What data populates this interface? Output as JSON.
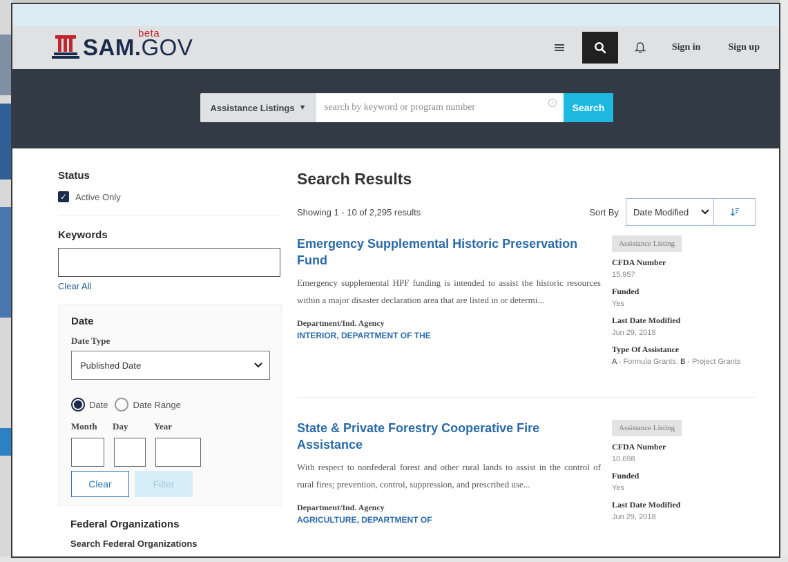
{
  "header": {
    "logo_main": "SAM.",
    "logo_gov": "GOV",
    "logo_beta": "beta",
    "sign_in": "Sign in",
    "sign_up": "Sign up"
  },
  "search": {
    "category": "Assistance Listings",
    "placeholder": "search by keyword or program number",
    "button": "Search"
  },
  "sidebar": {
    "status_title": "Status",
    "active_only": "Active Only",
    "keywords_title": "Keywords",
    "clear_all": "Clear All",
    "date_title": "Date",
    "date_type_label": "Date Type",
    "date_type_value": "Published Date",
    "radio_date": "Date",
    "radio_range": "Date Range",
    "month": "Month",
    "day": "Day",
    "year": "Year",
    "clear_btn": "Clear",
    "filter_btn": "Filter",
    "fed_title": "Federal Organizations",
    "fed_sub": "Search Federal Organizations"
  },
  "results": {
    "title": "Search Results",
    "showing": "Showing 1 - 10 of 2,295 results",
    "sort_label": "Sort By",
    "sort_value": "Date Modified",
    "items": [
      {
        "title": "Emergency Supplemental Historic Preservation Fund",
        "description": "Emergency supplemental HPF funding is intended to assist the historic resources within a major disaster declaration area that are listed in or determi...",
        "agency_label": "Department/Ind. Agency",
        "agency": "INTERIOR, DEPARTMENT OF THE",
        "tag": "Assistance Listing",
        "cfda_label": "CFDA Number",
        "cfda": "15.957",
        "funded_label": "Funded",
        "funded": "Yes",
        "modified_label": "Last Date Modified",
        "modified": "Jun 29, 2018",
        "type_label": "Type Of Assistance",
        "type_a_code": "A",
        "type_a": " - Formula Grants, ",
        "type_b_code": "B",
        "type_b": " - Project Grants"
      },
      {
        "title": "State & Private Forestry Cooperative Fire Assistance",
        "description": "With respect to nonfederal forest and other rural lands to assist in the control of rural fires; prevention, control, suppression, and prescribed use...",
        "agency_label": "Department/Ind. Agency",
        "agency": "AGRICULTURE, DEPARTMENT OF",
        "tag": "Assistance Listing",
        "cfda_label": "CFDA Number",
        "cfda": "10.698",
        "funded_label": "Funded",
        "funded": "Yes",
        "modified_label": "Last Date Modified",
        "modified": "Jun 29, 2018"
      }
    ]
  },
  "colors": {
    "header_bg": "#dfe1e2",
    "search_band": "#323a45",
    "search_button": "#1fb8e0",
    "link_blue": "#2a6aa8",
    "logo_red": "#c0272d",
    "logo_navy": "#1b2b4b"
  }
}
